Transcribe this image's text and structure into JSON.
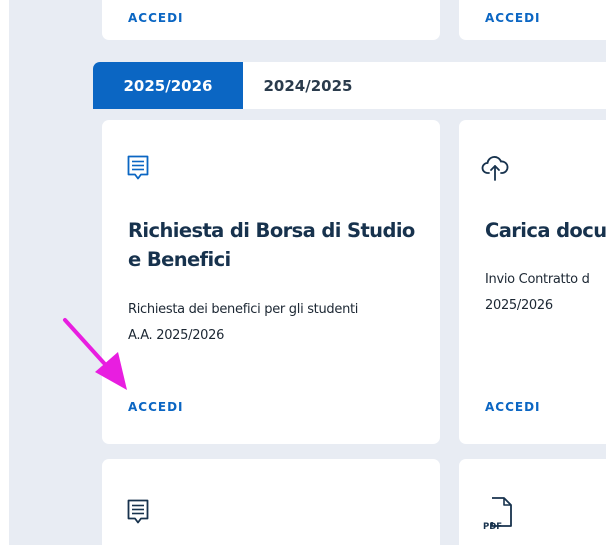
{
  "colors": {
    "accent": "#0b66c3",
    "title": "#17324d",
    "backdrop": "#e8ecf3",
    "annotation_arrow": "#e81ee0"
  },
  "top_cards": [
    {
      "action_label": "ACCEDI"
    },
    {
      "action_label": "ACCEDI"
    }
  ],
  "tabs": [
    {
      "label": "2025/2026",
      "active": true
    },
    {
      "label": "2024/2025",
      "active": false
    }
  ],
  "cards": [
    {
      "icon": "message-icon",
      "title_line1": "Richiesta di Borsa di Studio",
      "title_line2": "e Benefici",
      "desc_line1": "Richiesta dei benefici per gli studenti",
      "desc_line2": "A.A. 2025/2026",
      "action_label": "ACCEDI"
    },
    {
      "icon": "cloud-upload-icon",
      "title_line1": "Carica docu",
      "desc_line1": "Invio Contratto d",
      "desc_line2": "2025/2026",
      "action_label": "ACCEDI"
    }
  ],
  "bottom_cards": [
    {
      "icon": "message-icon"
    },
    {
      "icon": "pdf-file-icon",
      "badge": "PDF"
    }
  ]
}
